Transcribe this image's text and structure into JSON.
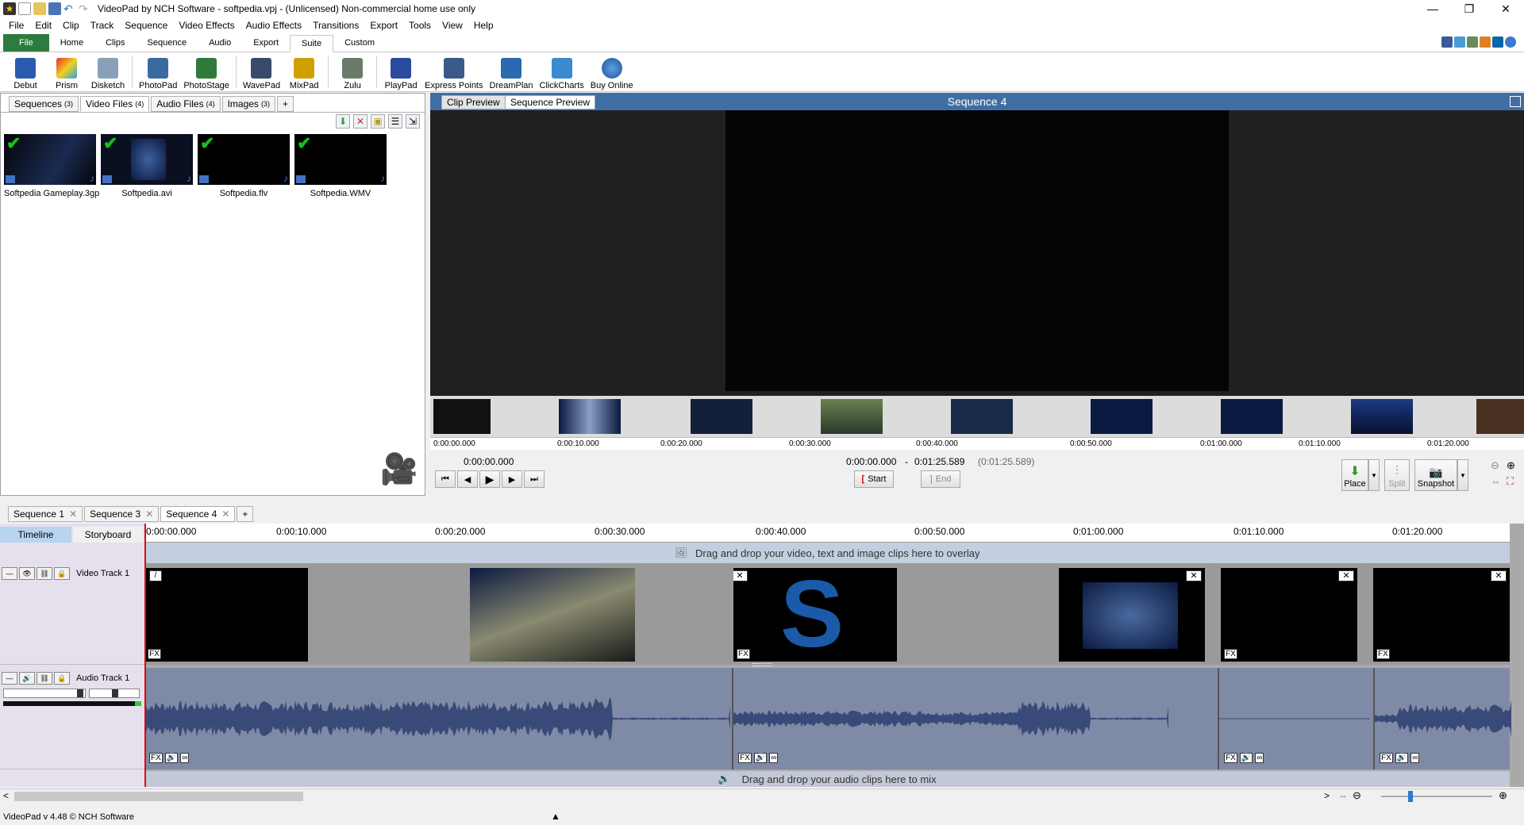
{
  "window": {
    "title": "VideoPad by NCH Software - softpedia.vpj - (Unlicensed) Non-commercial home use only",
    "minimize": "—",
    "maximize": "❐",
    "close": "✕"
  },
  "menu": [
    "File",
    "Edit",
    "Clip",
    "Track",
    "Sequence",
    "Video Effects",
    "Audio Effects",
    "Transitions",
    "Export",
    "Tools",
    "View",
    "Help"
  ],
  "ribbon_tabs": [
    "File",
    "Home",
    "Clips",
    "Sequence",
    "Audio",
    "Export",
    "Suite",
    "Custom"
  ],
  "toolbar": [
    "Debut",
    "Prism",
    "Disketch",
    "PhotoPad",
    "PhotoStage",
    "WavePad",
    "MixPad",
    "Zulu",
    "PlayPad",
    "Express Points",
    "DreamPlan",
    "ClickCharts",
    "Buy Online"
  ],
  "bin": {
    "tabs": [
      {
        "label": "Sequences",
        "count": "(3)"
      },
      {
        "label": "Video Files",
        "count": "(4)"
      },
      {
        "label": "Audio Files",
        "count": "(4)"
      },
      {
        "label": "Images",
        "count": "(3)"
      },
      {
        "label": "+",
        "count": ""
      }
    ],
    "files": [
      "Softpedia Gameplay.3gp",
      "Softpedia.avi",
      "Softpedia.flv",
      "Softpedia.WMV"
    ]
  },
  "preview": {
    "tab_clip": "Clip Preview",
    "tab_sequence": "Sequence Preview",
    "title": "Sequence 4",
    "ruler": [
      "0:00:00.000",
      "0:00:10.000",
      "0:00:20.000",
      "0:00:30.000",
      "0:00:40.000",
      "0:00:50.000",
      "0:01:00.000",
      "0:01:10.000",
      "0:01:20.000"
    ],
    "current_time": "0:00:00.000",
    "range_start": "0:00:00.000",
    "range_sep": "-",
    "range_end": "0:01:25.589",
    "duration": "(0:01:25.589)",
    "start_label": "Start",
    "end_label": "End",
    "place_label": "Place",
    "split_label": "Split",
    "snapshot_label": "Snapshot"
  },
  "sequence_tabs": [
    "Sequence 1",
    "Sequence 3",
    "Sequence 4",
    "+"
  ],
  "timeline": {
    "view_timeline": "Timeline",
    "view_storyboard": "Storyboard",
    "ticks": [
      "0:00:00.000",
      "0:00:10.000",
      "0:00:20.000",
      "0:00:30.000",
      "0:00:40.000",
      "0:00:50.000",
      "0:01:00.000",
      "0:01:10.000",
      "0:01:20.000"
    ],
    "overlay_hint": "Drag and drop your video, text and image clips here to overlay",
    "video_track": "Video Track 1",
    "audio_track": "Audio Track 1",
    "audio_hint": "Drag and drop your audio clips here to mix",
    "fx": "FX"
  },
  "status": "VideoPad v 4.48 © NCH Software",
  "colors": {
    "accent": "#3f6ea5",
    "file_tab": "#2c7c3f",
    "playhead": "#e00000",
    "wave": "#3a4a78"
  }
}
